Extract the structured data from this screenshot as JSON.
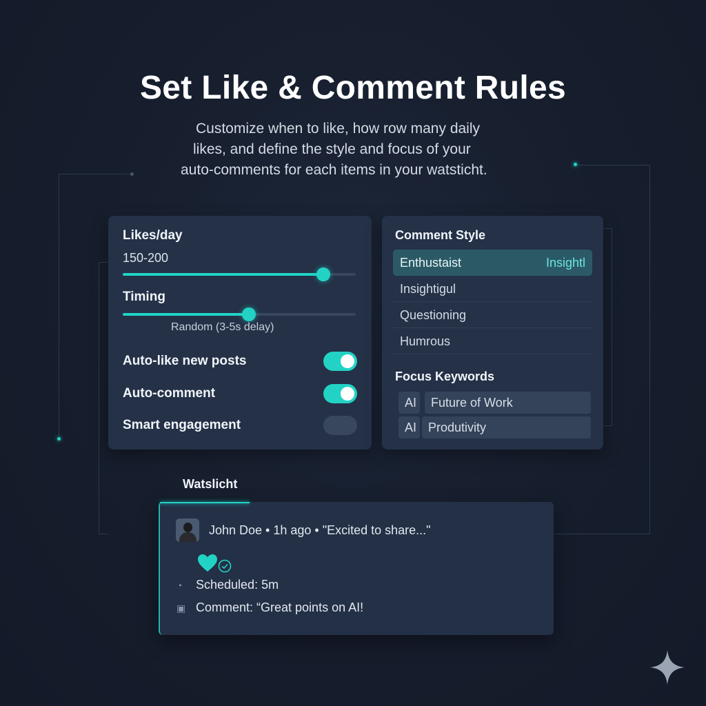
{
  "header": {
    "title": "Set Like & Comment Rules",
    "subtitle_lines": [
      "Customize when to like, how row many daily",
      "likes, and define the style and focus of your",
      "auto-comments for each items in your watsticht."
    ]
  },
  "rules_panel": {
    "likes_label": "Likes/day",
    "likes_value": "150-200",
    "likes_slider_level": 0.86,
    "timing_label": "Timing",
    "timing_slider_level": 0.54,
    "timing_hint": "Random (3-5s delay)",
    "toggles": [
      {
        "label": "Auto-like new posts",
        "state": "on"
      },
      {
        "label": "Auto-comment",
        "state": "on"
      },
      {
        "label": "Smart engagement",
        "state": "off"
      }
    ]
  },
  "style_panel": {
    "comment_style_title": "Comment Style",
    "styles": [
      {
        "label": "Enthustaist",
        "tag": "Insightl",
        "selected": true
      },
      {
        "label": "Insightigul",
        "tag": "",
        "selected": false
      },
      {
        "label": "Questioning",
        "tag": "",
        "selected": false
      },
      {
        "label": "Humrous",
        "tag": "",
        "selected": false
      }
    ],
    "focus_title": "Focus Keywords",
    "keywords": [
      {
        "prefix": "AI",
        "text": "Future of Work"
      },
      {
        "prefix": "AI",
        "text": "Produtivity"
      }
    ]
  },
  "watchlist": {
    "tab_label": "Watslicht",
    "post_meta": "John Doe • 1h ago • \"Excited to share...\"",
    "scheduled": "Scheduled: 5m",
    "comment": "Comment: “Great points on AI!"
  },
  "colors": {
    "accent": "#22d3c5",
    "card": "#243147",
    "background": "#161d2c"
  },
  "icons": [
    "avatar",
    "heart-icon",
    "check-circle-icon",
    "clock-icon",
    "comment-icon",
    "sparkle-icon"
  ]
}
